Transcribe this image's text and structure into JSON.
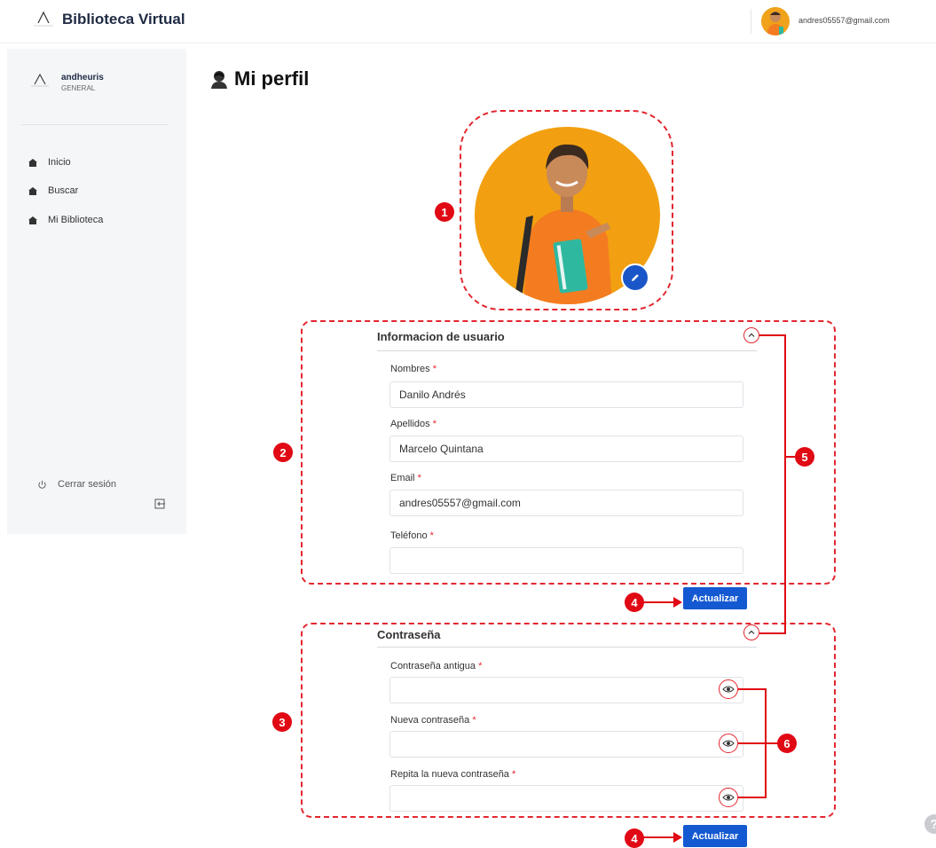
{
  "header": {
    "app_title": "Biblioteca Virtual",
    "user_email": "andres05557@gmail.com"
  },
  "sidebar": {
    "username": "andheuris",
    "role": "GENERAL",
    "items": [
      {
        "label": "Inicio",
        "icon": "home-icon"
      },
      {
        "label": "Buscar",
        "icon": "home-icon"
      },
      {
        "label": "Mi Biblioteca",
        "icon": "home-icon"
      }
    ],
    "logout_label": "Cerrar sesión"
  },
  "page": {
    "title": "Mi perfil"
  },
  "user_info": {
    "section_title": "Informacion de usuario",
    "nombres_label": "Nombres",
    "nombres_value": "Danilo Andrés",
    "apellidos_label": "Apellidos",
    "apellidos_value": "Marcelo Quintana",
    "email_label": "Email",
    "email_value": "andres05557@gmail.com",
    "telefono_label": "Teléfono",
    "telefono_value": "",
    "required_mark": "*",
    "update_label": "Actualizar"
  },
  "password": {
    "section_title": "Contraseña",
    "old_label": "Contraseña antigua",
    "new_label": "Nueva contraseña",
    "repeat_label": "Repita la nueva contraseña",
    "required_mark": "*",
    "update_label": "Actualizar"
  },
  "annotations": {
    "b1": "1",
    "b2": "2",
    "b3": "3",
    "b4a": "4",
    "b4b": "4",
    "b5": "5",
    "b6": "6"
  },
  "help": "?",
  "colors": {
    "accent_blue": "#1459d1",
    "annotation_red": "#e00914",
    "photo_bg": "#f2a011"
  }
}
